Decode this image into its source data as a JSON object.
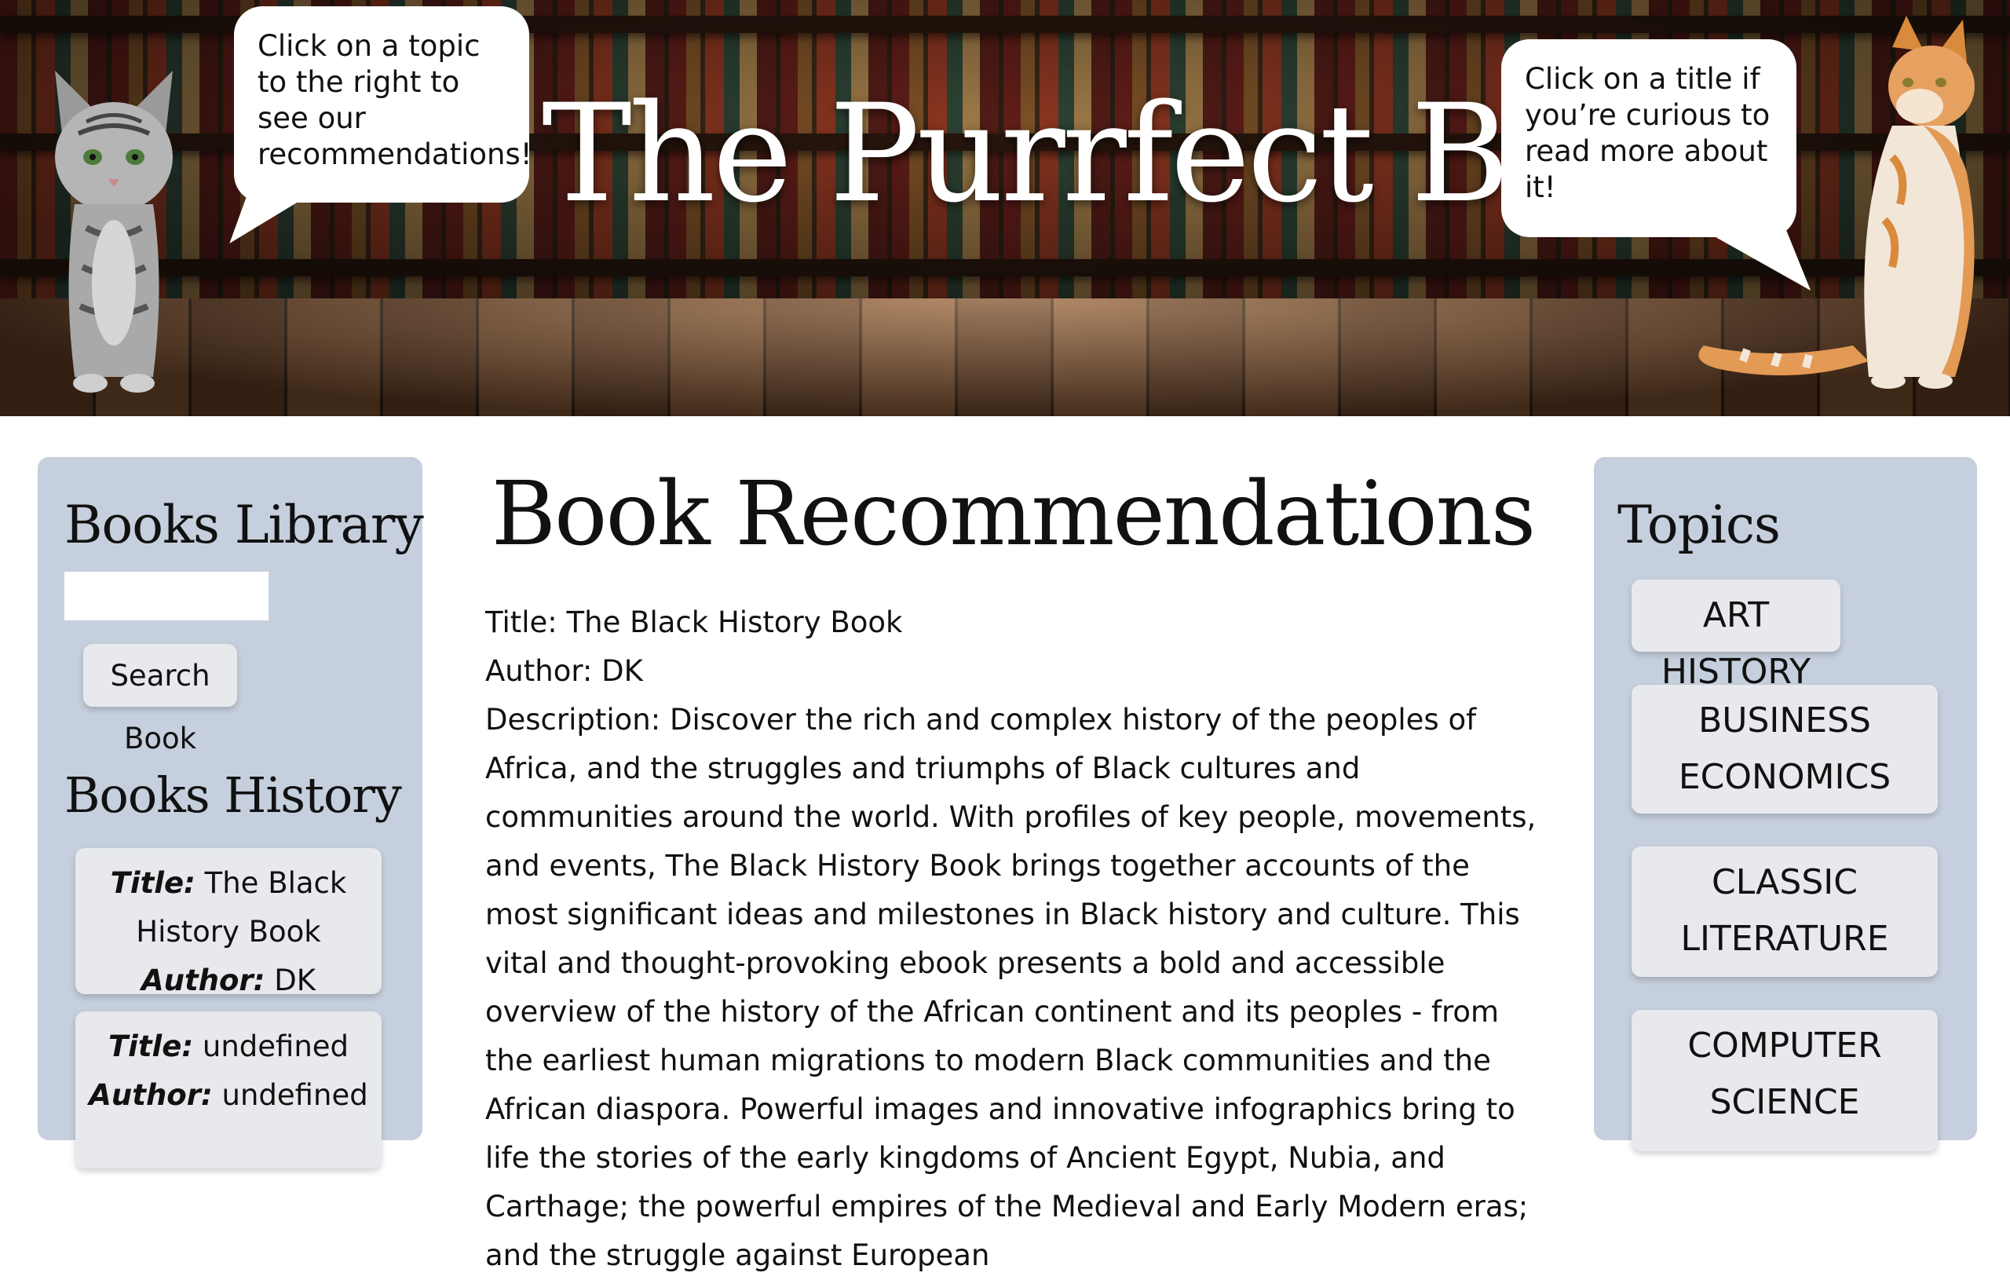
{
  "header": {
    "title": "The Purrfect Book",
    "bubble_left": "Click on a topic to the right to see our recommendations!",
    "bubble_right": "Click on a title if you’re curious to read more about it!"
  },
  "library": {
    "heading": "Books Library",
    "search_value": "",
    "search_button": "Search Book"
  },
  "history": {
    "heading": "Books History",
    "title_key": "Title:",
    "author_key": "Author:",
    "items": [
      {
        "title": "The Black History Book",
        "author": "DK"
      },
      {
        "title": "undefined",
        "author": "undefined"
      }
    ]
  },
  "main": {
    "heading": "Book Recommendations",
    "title_line": "Title: The Black History Book",
    "author_line": "Author: DK",
    "description": "Description: Discover the rich and complex history of the peoples of Africa, and the struggles and triumphs of Black cultures and communities around the world. With profiles of key people, movements, and events, The Black History Book brings together accounts of the most significant ideas and milestones in Black history and culture. This vital and thought-provoking ebook presents a bold and accessible overview of the history of the African continent and its peoples - from the earliest human migrations to modern Black communities and the African diaspora. Powerful images and innovative infographics bring to life the stories of the early kingdoms of Ancient Egypt, Nubia, and Carthage; the powerful empires of the Medieval and Early Modern eras; and the struggle against European"
  },
  "topics": {
    "heading": "Topics",
    "items": [
      "ART HISTORY",
      "BUSINESS ECONOMICS",
      "CLASSIC LITERATURE",
      "COMPUTER SCIENCE"
    ]
  },
  "colors": {
    "panel": "#c6cfdd",
    "button": "#e7e9ed"
  }
}
